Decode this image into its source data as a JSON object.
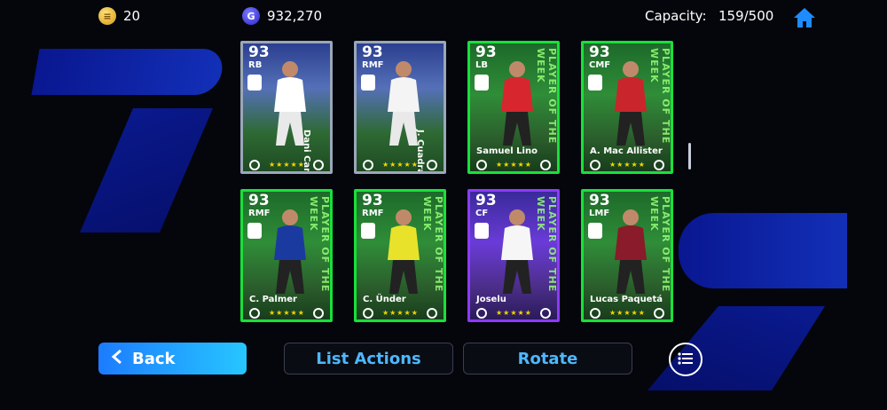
{
  "topbar": {
    "coins": "20",
    "gp": "932,270",
    "capacity_label": "Capacity:",
    "capacity_value": "159/500"
  },
  "cards": [
    {
      "rating": "93",
      "position": "RB",
      "name": "Dani Carvajal",
      "theme": "white"
    },
    {
      "rating": "93",
      "position": "RMF",
      "name": "J. Cuadrado",
      "theme": "white"
    },
    {
      "rating": "93",
      "position": "LB",
      "name": "Samuel Lino",
      "theme": "green"
    },
    {
      "rating": "93",
      "position": "CMF",
      "name": "A. Mac Allister",
      "theme": "green"
    },
    {
      "rating": "93",
      "position": "RMF",
      "name": "C. Palmer",
      "theme": "green"
    },
    {
      "rating": "93",
      "position": "RMF",
      "name": "C. Ünder",
      "theme": "green"
    },
    {
      "rating": "93",
      "position": "CF",
      "name": "Joselu",
      "theme": "purple"
    },
    {
      "rating": "93",
      "position": "LMF",
      "name": "Lucas Paquetá",
      "theme": "green"
    }
  ],
  "watermark": "PLAYER OF THE WEEK",
  "stars": "★★★★★",
  "buttons": {
    "back": "Back",
    "list_actions": "List Actions",
    "rotate": "Rotate"
  },
  "colors": {
    "accent": "#27c6ff",
    "card_green": "#19e03a",
    "card_purple": "#8b3bff",
    "star": "#f2d500"
  },
  "icons": {
    "coin": "gold-coin-icon",
    "gp": "gp-coin-icon",
    "home": "home-icon",
    "back": "chevron-left-icon",
    "menu": "list-menu-icon"
  }
}
